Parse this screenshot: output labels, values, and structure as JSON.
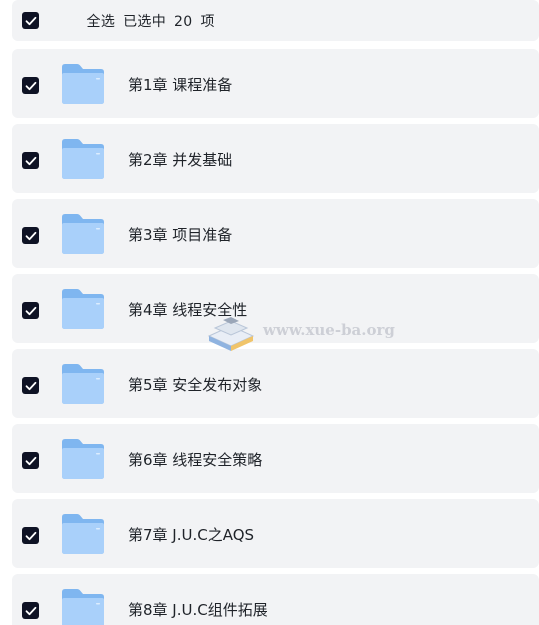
{
  "select_all": {
    "label": "全选",
    "selected_prefix": "已选中",
    "selected_count": "20",
    "selected_suffix": "项",
    "checked": true
  },
  "folders": [
    {
      "name": "第1章 课程准备",
      "checked": true
    },
    {
      "name": "第2章 并发基础",
      "checked": true
    },
    {
      "name": "第3章 项目准备",
      "checked": true
    },
    {
      "name": "第4章 线程安全性",
      "checked": true
    },
    {
      "name": "第5章 安全发布对象",
      "checked": true
    },
    {
      "name": "第6章 线程安全策略",
      "checked": true
    },
    {
      "name": "第7章 J.U.C之AQS",
      "checked": true
    },
    {
      "name": "第8章 J.U.C组件拓展",
      "checked": true
    }
  ],
  "watermark": {
    "text": "www.xue-ba.org"
  },
  "colors": {
    "checkbox_fill": "#0f1325",
    "row_background": "#f2f3f5",
    "folder_back": "#7fb6f0",
    "folder_front": "#a9d0fa",
    "text": "#1f2329"
  },
  "icons": {
    "checkbox": "check-icon",
    "folder": "folder-icon",
    "watermark_logo": "book-stack-logo"
  }
}
